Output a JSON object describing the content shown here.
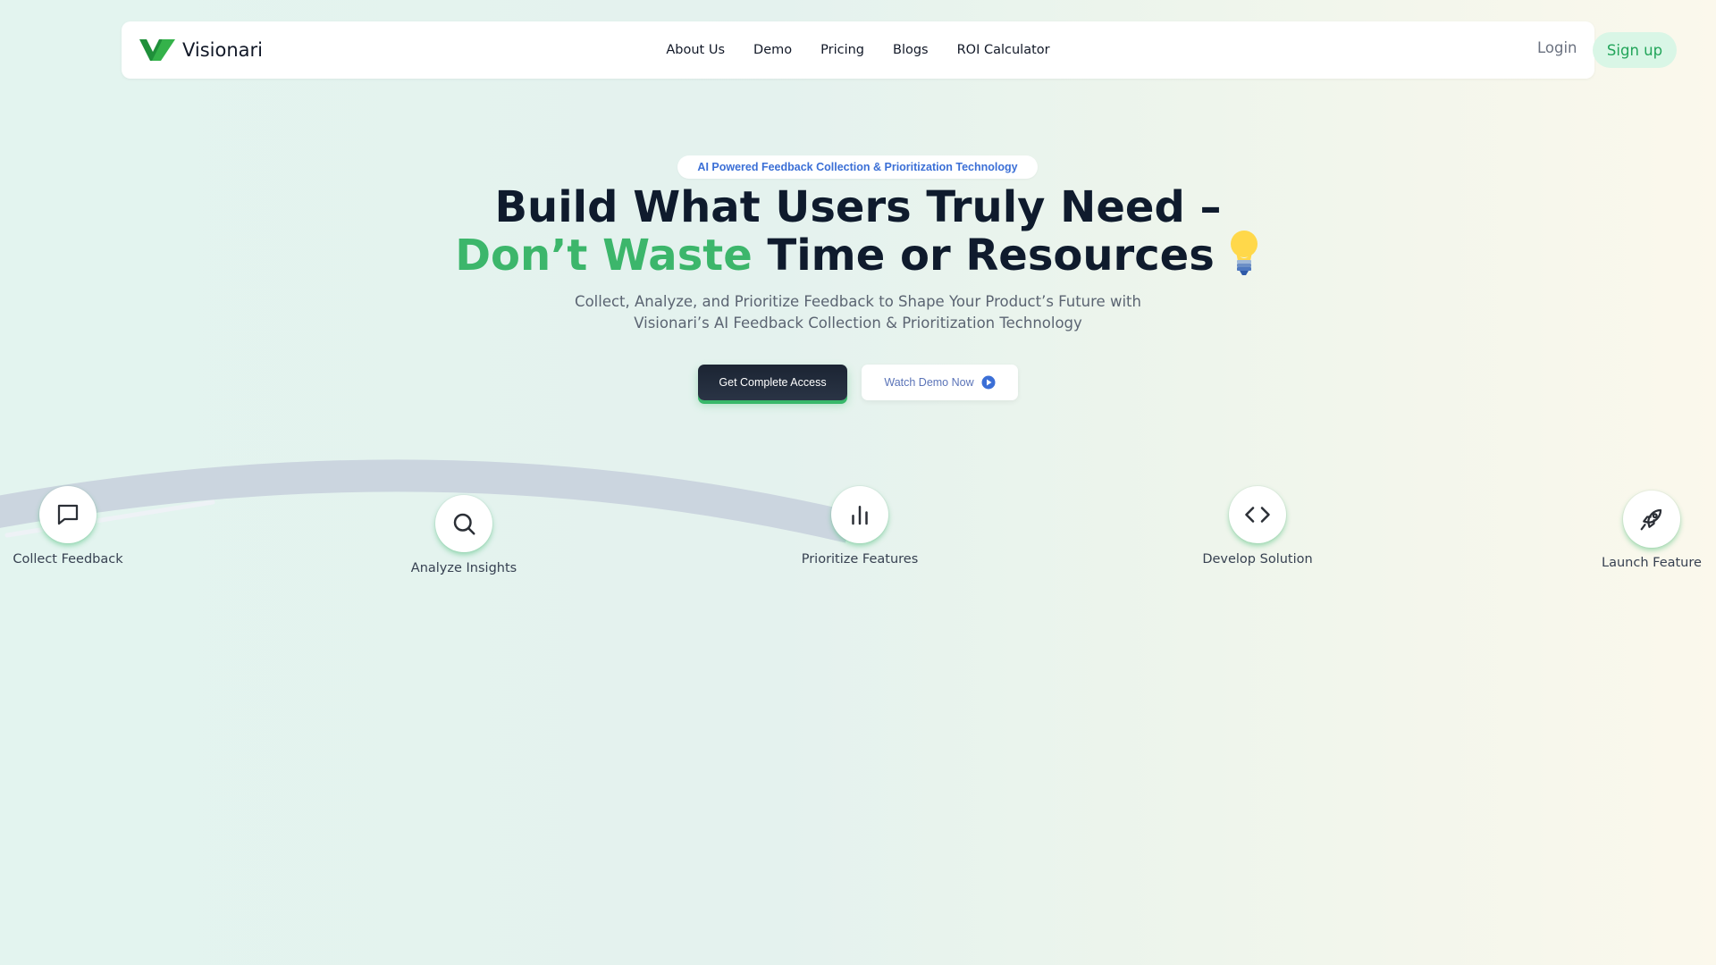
{
  "nav": {
    "brand": "Visionari",
    "links": [
      "About Us",
      "Demo",
      "Pricing",
      "Blogs",
      "ROI Calculator"
    ],
    "login": "Login",
    "signup": "Sign up"
  },
  "hero": {
    "tag": "AI Powered Feedback Collection & Prioritization Technology",
    "headline_line1": "Build What Users Truly Need –",
    "headline_highlight": "Don’t Waste",
    "headline_line2_rest": "Time or Resources",
    "subtitle_line1": "Collect, Analyze, and Prioritize Feedback to Shape Your Product’s Future with",
    "subtitle_line2": "Visionari’s AI Feedback Collection & Prioritization Technology",
    "primary_cta": "Get Complete Access",
    "secondary_cta": "Watch Demo Now"
  },
  "steps": [
    {
      "label": "Collect Feedback",
      "icon": "message-icon"
    },
    {
      "label": "Analyze Insights",
      "icon": "search-icon"
    },
    {
      "label": "Prioritize Features",
      "icon": "bar-chart-icon"
    },
    {
      "label": "Develop Solution",
      "icon": "code-icon"
    },
    {
      "label": "Launch Feature",
      "icon": "rocket-icon"
    }
  ],
  "colors": {
    "accent_green": "#3cb66b",
    "tag_blue": "#3b6fd6",
    "dark": "#0f1b2d",
    "track_gray": "#cbd5df"
  }
}
